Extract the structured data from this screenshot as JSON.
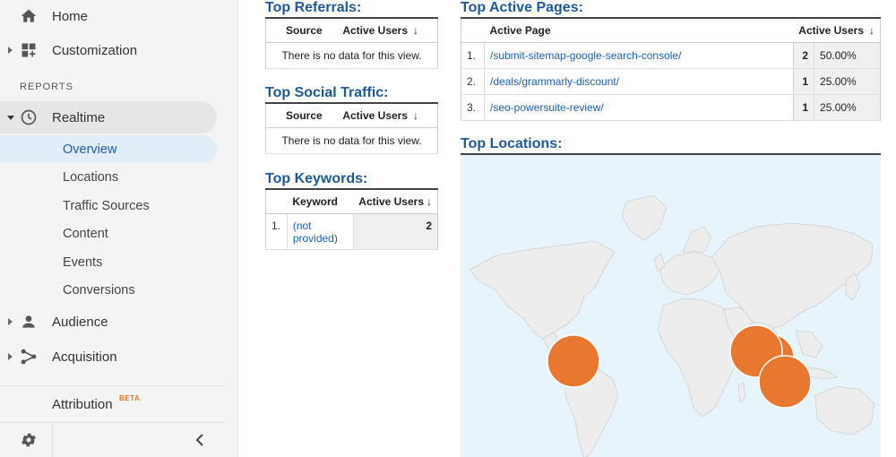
{
  "sidebar": {
    "home": "Home",
    "customization": "Customization",
    "reports_label": "REPORTS",
    "realtime": "Realtime",
    "realtime_items": [
      "Overview",
      "Locations",
      "Traffic Sources",
      "Content",
      "Events",
      "Conversions"
    ],
    "audience": "Audience",
    "acquisition": "Acquisition",
    "attribution": "Attribution",
    "beta": "BETA"
  },
  "referrals": {
    "title": "Top Referrals:",
    "col_source": "Source",
    "col_users": "Active Users",
    "empty": "There is no data for this view."
  },
  "social": {
    "title": "Top Social Traffic:",
    "col_source": "Source",
    "col_users": "Active Users",
    "empty": "There is no data for this view."
  },
  "keywords": {
    "title": "Top Keywords:",
    "col_keyword": "Keyword",
    "col_users": "Active Users",
    "rows": [
      {
        "index": "1.",
        "keyword": "(not provided)",
        "users": "2"
      }
    ]
  },
  "active_pages": {
    "title": "Top Active Pages:",
    "col_page": "Active Page",
    "col_users": "Active Users",
    "rows": [
      {
        "index": "1.",
        "page": "/submit-sitemap-google-search-console/",
        "users": "2",
        "pct": "50.00%"
      },
      {
        "index": "2.",
        "page": "/deals/grammarly-discount/",
        "users": "1",
        "pct": "25.00%"
      },
      {
        "index": "3.",
        "page": "/seo-powersuite-review/",
        "users": "1",
        "pct": "25.00%"
      }
    ]
  },
  "locations": {
    "title": "Top Locations:",
    "bubble_color": "#e8782f"
  },
  "colors": {
    "accent": "#1f5a98",
    "link": "#1a5fb4",
    "bubble": "#e8782f"
  }
}
